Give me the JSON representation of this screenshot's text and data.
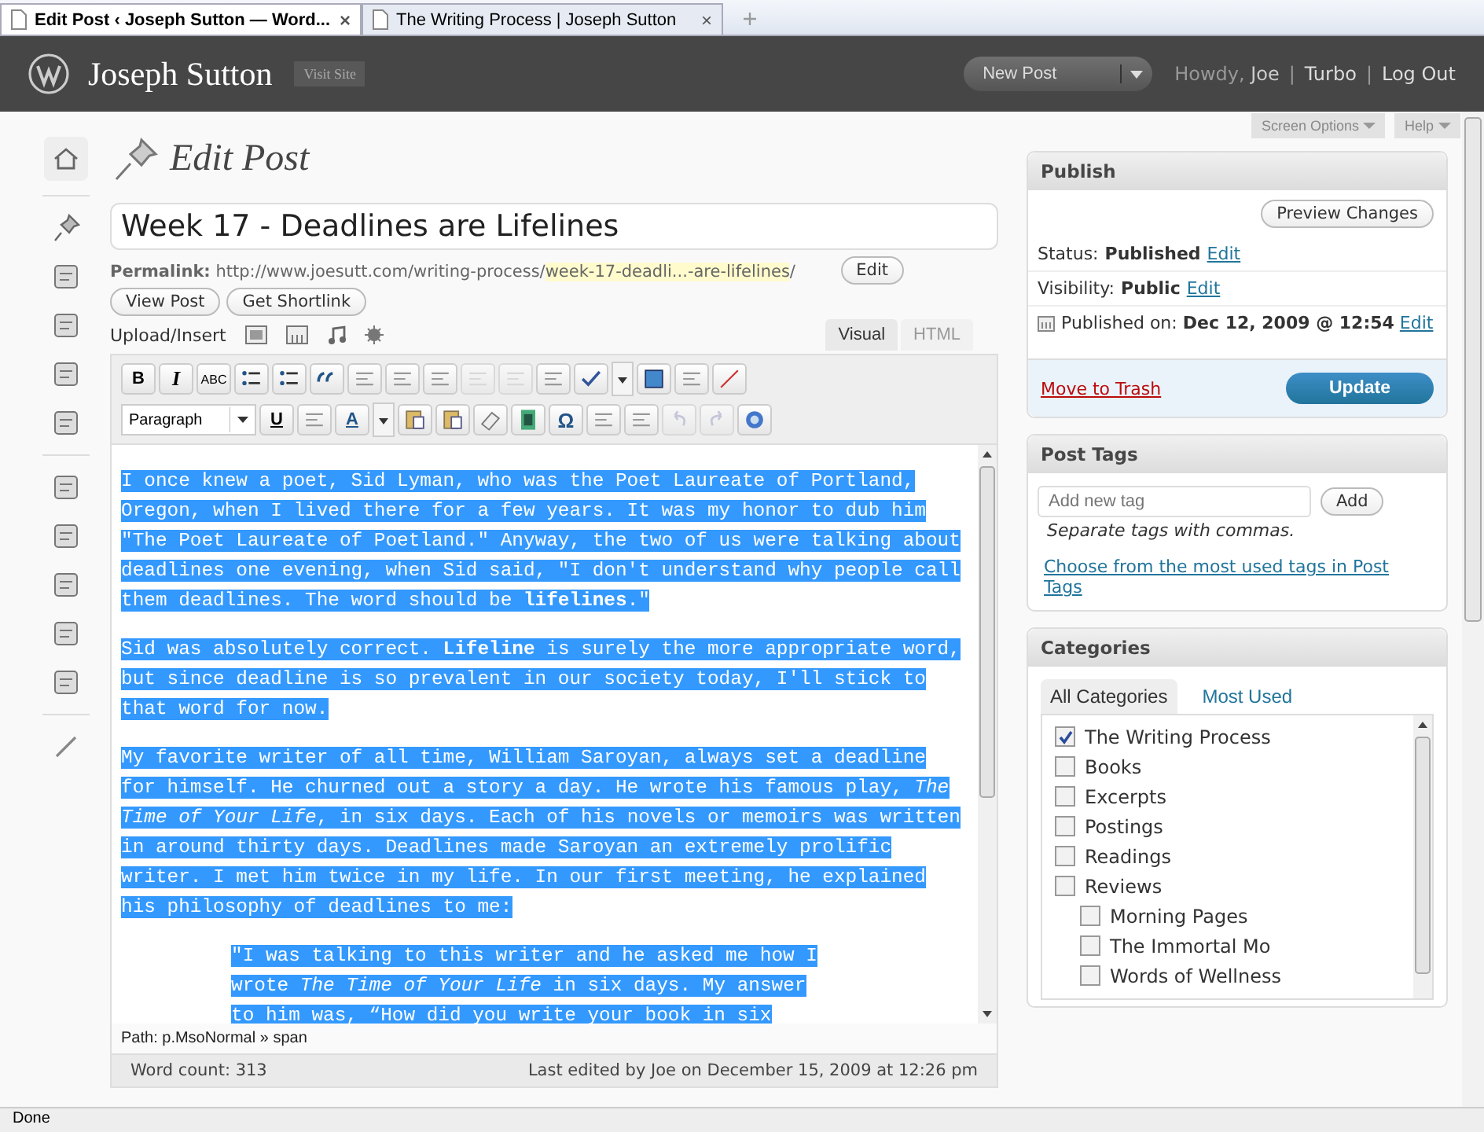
{
  "browser_tabs": [
    {
      "title": "Edit Post ‹ Joseph Sutton — Word...",
      "close": "×",
      "selected": true
    },
    {
      "title": "The Writing Process | Joseph Sutton",
      "close": "×",
      "selected": false
    }
  ],
  "admin_bar": {
    "site_name": "Joseph Sutton",
    "visit_site": "Visit Site",
    "new_post": "New Post",
    "greeting": "Howdy,",
    "user": "Joe",
    "links": [
      {
        "separator": "|",
        "label": "Turbo"
      },
      {
        "separator": "|",
        "label": "Log Out"
      }
    ],
    "screen_options": "Screen Options",
    "help": "Help"
  },
  "page_title": "Edit Post",
  "post": {
    "title": "Week 17 - Deadlines are Lifelines",
    "permalink_label": "Permalink:",
    "permalink_base": "http://www.joesutt.com/writing-process/",
    "permalink_slug": "week-17-deadli...-are-lifelines",
    "permalink_end": "/",
    "edit": "Edit",
    "view_post": "View Post",
    "get_shortlink": "Get Shortlink",
    "upload_insert": "Upload/Insert"
  },
  "editor_tabs": [
    {
      "label": "Visual",
      "selected": true
    },
    {
      "label": "HTML",
      "selected": false
    }
  ],
  "toolbar": {
    "bold": "B",
    "italic": "I",
    "strike": "ABC",
    "format": "Paragraph",
    "underline": "U",
    "text_color": "A",
    "special_char": "Ω"
  },
  "editor": {
    "text_selected": true,
    "paragraphs": [
      {
        "kind": "para",
        "text": "I once knew a poet, Sid Lyman, who was the Poet Laureate of Portland, Oregon, when I lived there for a few years. It was my honor to dub him \"The Poet Laureate of Poetland.\" Anyway, the two of us were talking about deadlines one evening, when Sid said, \"I don't understand why people call them deadlines. The word should be **lifelines**.\""
      },
      {
        "kind": "para",
        "text": "Sid was absolutely correct. **Lifeline** is surely the more appropriate word, but since deadline is so prevalent in our society today, I'll stick to that word for now."
      },
      {
        "kind": "para",
        "text": "My favorite writer of all time, William Saroyan, always set a deadline for himself. He churned out a story a day. He wrote his famous play, *The Time of Your Life*, in six days. Each of his novels or memoirs was written in around thirty days. Deadlines made Saroyan an extremely prolific writer. I met him twice in my life. In our first meeting, he explained his philosophy of deadlines to me:"
      },
      {
        "kind": "quote",
        "text": "\"I was talking to this writer and he asked me how I wrote *The Time of Your Life* in six days. My answer to him was, “How did you write your book in six"
      }
    ]
  },
  "path": "Path: p.MsoNormal » span",
  "word_count": "Word count: 313",
  "last_edited": "Last edited by Joe on December 15, 2009 at 12:26 pm",
  "publish": {
    "title": "Publish",
    "preview": "Preview Changes",
    "status_label": "Status:",
    "status": "Published",
    "visibility_label": "Visibility:",
    "visibility": "Public",
    "published_label": "Published on:",
    "published": "Dec 12, 2009 @ 12:54",
    "status_edit": "Edit",
    "visibility_edit": "Edit",
    "published_edit": "Edit",
    "trash": "Move to Trash",
    "update": "Update"
  },
  "post_tags": {
    "title": "Post Tags",
    "placeholder": "Add new tag",
    "add": "Add",
    "hint": "Separate tags with commas.",
    "choose": "Choose from the most used tags in Post Tags"
  },
  "categories": {
    "title": "Categories",
    "tabs": [
      {
        "label": "All Categories",
        "selected": true
      },
      {
        "label": "Most Used",
        "selected": false
      }
    ],
    "items": [
      {
        "label": "The Writing Process",
        "checked": true
      },
      {
        "label": "Books",
        "checked": false
      },
      {
        "label": "Excerpts",
        "checked": false
      },
      {
        "label": "Postings",
        "checked": false
      },
      {
        "label": "Readings",
        "checked": false
      },
      {
        "label": "Reviews",
        "checked": false,
        "children": [
          {
            "label": "Morning Pages",
            "checked": false
          },
          {
            "label": "The Immortal Mo",
            "checked": false
          },
          {
            "label": "Words of Wellness",
            "checked": false
          }
        ]
      }
    ]
  },
  "status_bar": "Done"
}
